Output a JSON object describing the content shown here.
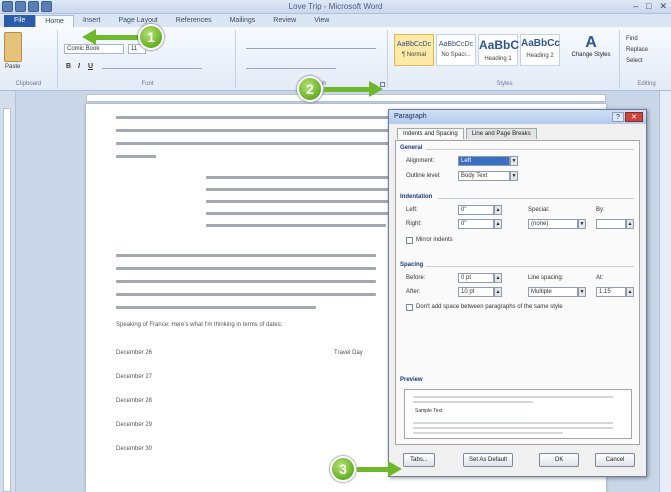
{
  "window": {
    "title": "Love Trip - Microsoft Word",
    "controls": [
      "–",
      "□",
      "✕"
    ]
  },
  "tabs": [
    "File",
    "Home",
    "Insert",
    "Page Layout",
    "References",
    "Mailings",
    "Review",
    "View"
  ],
  "ribbon": {
    "clipboard_label": "Clipboard",
    "paste_label": "Paste",
    "font_name": "Comic Book",
    "font_size": "11",
    "font_label": "Font",
    "paragraph_label": "Paragraph",
    "styles_label": "Styles",
    "editing_label": "Editing",
    "styles": [
      {
        "preview": "AaBbCcDc",
        "name": "¶ Normal"
      },
      {
        "preview": "AaBbCcDc",
        "name": "No Spaci..."
      },
      {
        "preview": "AaBbC",
        "name": "Heading 1"
      },
      {
        "preview": "AaBbCc",
        "name": "Heading 2"
      }
    ],
    "change_styles": "Change Styles",
    "find": "Find",
    "replace": "Replace",
    "select": "Select"
  },
  "document": {
    "date_col_title": "Travel Day",
    "days": [
      "December 26",
      "December 27",
      "December 28",
      "December 29",
      "December 30"
    ],
    "speaking_line": "Speaking of France: Here's what I'm thinking in terms of dates:"
  },
  "callouts": [
    "1",
    "2",
    "3"
  ],
  "dialog": {
    "title": "Paragraph",
    "help": "?",
    "close": "✕",
    "tabs": [
      "Indents and Spacing",
      "Line and Page Breaks"
    ],
    "general": {
      "heading": "General",
      "alignment_label": "Alignment:",
      "alignment_value": "Left",
      "outline_label": "Outline level:",
      "outline_value": "Body Text"
    },
    "indentation": {
      "heading": "Indentation",
      "left_label": "Left:",
      "left_value": "0\"",
      "right_label": "Right:",
      "right_value": "0\"",
      "special_label": "Special:",
      "special_value": "(none)",
      "by_label": "By:",
      "mirror_label": "Mirror indents"
    },
    "spacing": {
      "heading": "Spacing",
      "before_label": "Before:",
      "before_value": "0 pt",
      "after_label": "After:",
      "after_value": "10 pt",
      "line_label": "Line spacing:",
      "line_value": "Multiple",
      "at_label": "At:",
      "at_value": "1.15",
      "dont_add_label": "Don't add space between paragraphs of the same style"
    },
    "preview": {
      "heading": "Preview",
      "sample_words": "Sample Text"
    },
    "buttons": {
      "tabs": "Tabs...",
      "default": "Set As Default",
      "ok": "OK",
      "cancel": "Cancel"
    }
  }
}
